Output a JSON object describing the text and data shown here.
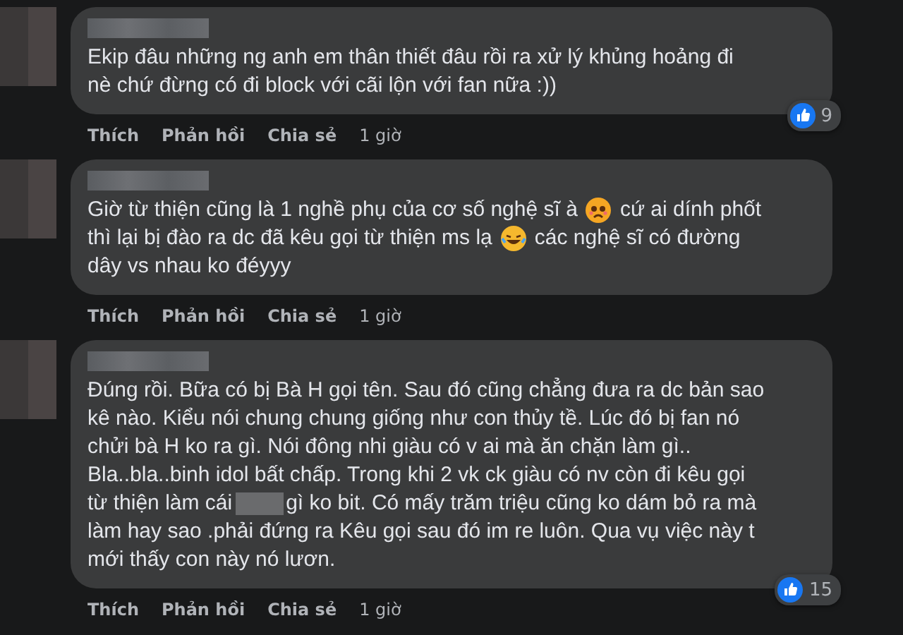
{
  "comments": [
    {
      "lines": [
        [
          {
            "kind": "text",
            "text": "Ekip đâu những ng anh em thân thiết đâu rồi ra xử lý khủng hoảng đi"
          }
        ],
        [
          {
            "kind": "text",
            "text": "nè chứ đừng có đi block với cãi lộn với fan nữa :))"
          }
        ]
      ],
      "actions": [
        "Thích",
        "Phản hồi",
        "Chia sẻ"
      ],
      "time": "1 giờ",
      "reactions": "9"
    },
    {
      "lines": [
        [
          {
            "kind": "text",
            "text": "Giờ từ thiện cũng là 1 nghề phụ của cơ số nghệ sĩ à"
          },
          {
            "kind": "sad-emoji"
          },
          {
            "kind": "text",
            "text": "cứ ai dính phốt"
          }
        ],
        [
          {
            "kind": "text",
            "text": "thì lại bị đào ra dc đã kêu gọi từ thiện ms lạ"
          },
          {
            "kind": "laugh-emoji"
          },
          {
            "kind": "text",
            "text": "các nghệ sĩ có đường"
          }
        ],
        [
          {
            "kind": "text",
            "text": "dây vs nhau ko đéyyy"
          }
        ]
      ],
      "actions": [
        "Thích",
        "Phản hồi",
        "Chia sẻ"
      ],
      "time": "1 giờ"
    },
    {
      "lines": [
        [
          {
            "kind": "text",
            "text": "Đúng rồi. Bữa có bị Bà H gọi tên. Sau đó cũng chẳng đưa ra dc bản sao"
          }
        ],
        [
          {
            "kind": "text",
            "text": "kê nào. Kiểu nói chung chung giống như con thủy tề. Lúc đó bị fan nó"
          }
        ],
        [
          {
            "kind": "text",
            "text": "chửi bà H ko ra gì. Nói đông nhi giàu có v ai mà ăn chặn làm gì.."
          }
        ],
        [
          {
            "kind": "text",
            "text": "Bla..bla..binh idol bất chấp. Trong khi 2 vk ck giàu có nv còn đi kêu gọi"
          }
        ],
        [
          {
            "kind": "text",
            "text": "từ thiện làm cái"
          },
          {
            "kind": "redacted"
          },
          {
            "kind": "text",
            "text": "gì ko bit. Có mấy trăm triệu cũng ko dám bỏ ra mà"
          }
        ],
        [
          {
            "kind": "text",
            "text": "làm hay sao .phải đứng ra Kêu gọi sau đó im re luôn. Qua vụ việc này t"
          }
        ],
        [
          {
            "kind": "text",
            "text": "mới thấy con này nó lươn."
          }
        ]
      ],
      "actions": [
        "Thích",
        "Phản hồi",
        "Chia sẻ"
      ],
      "time": "1 giờ",
      "reactions": "15"
    }
  ]
}
